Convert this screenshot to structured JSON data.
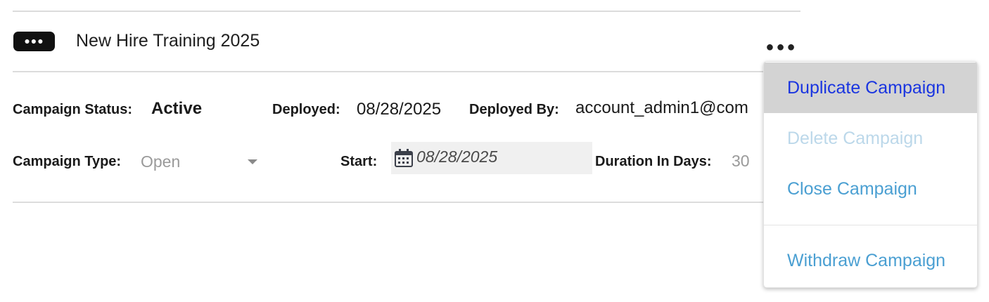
{
  "campaign": {
    "badge_icon": "ellipsis-icon",
    "title": "New Hire Training 2025",
    "more_icon": "more-horizontal-icon"
  },
  "details": {
    "status_label": "Campaign Status:",
    "status_value": "Active",
    "deployed_label": "Deployed:",
    "deployed_value": "08/28/2025",
    "deployed_by_label": "Deployed By:",
    "deployed_by_value": "account_admin1@com",
    "type_label": "Campaign Type:",
    "type_value": "Open",
    "start_label": "Start:",
    "start_value": "08/28/2025",
    "duration_label": "Duration In Days:",
    "duration_value": "30"
  },
  "menu": {
    "items": [
      {
        "label": "Duplicate Campaign",
        "state": "highlighted"
      },
      {
        "label": "Delete Campaign",
        "state": "disabled"
      },
      {
        "label": "Close Campaign",
        "state": "enabled"
      },
      {
        "label": "Withdraw Campaign",
        "state": "enabled"
      }
    ]
  },
  "colors": {
    "highlight_text": "#1a35e0",
    "highlight_bg": "#d3d3d3",
    "link_text": "#4a9fd2",
    "disabled_text": "#bcd8ea",
    "muted_text": "#9a9a9a"
  }
}
